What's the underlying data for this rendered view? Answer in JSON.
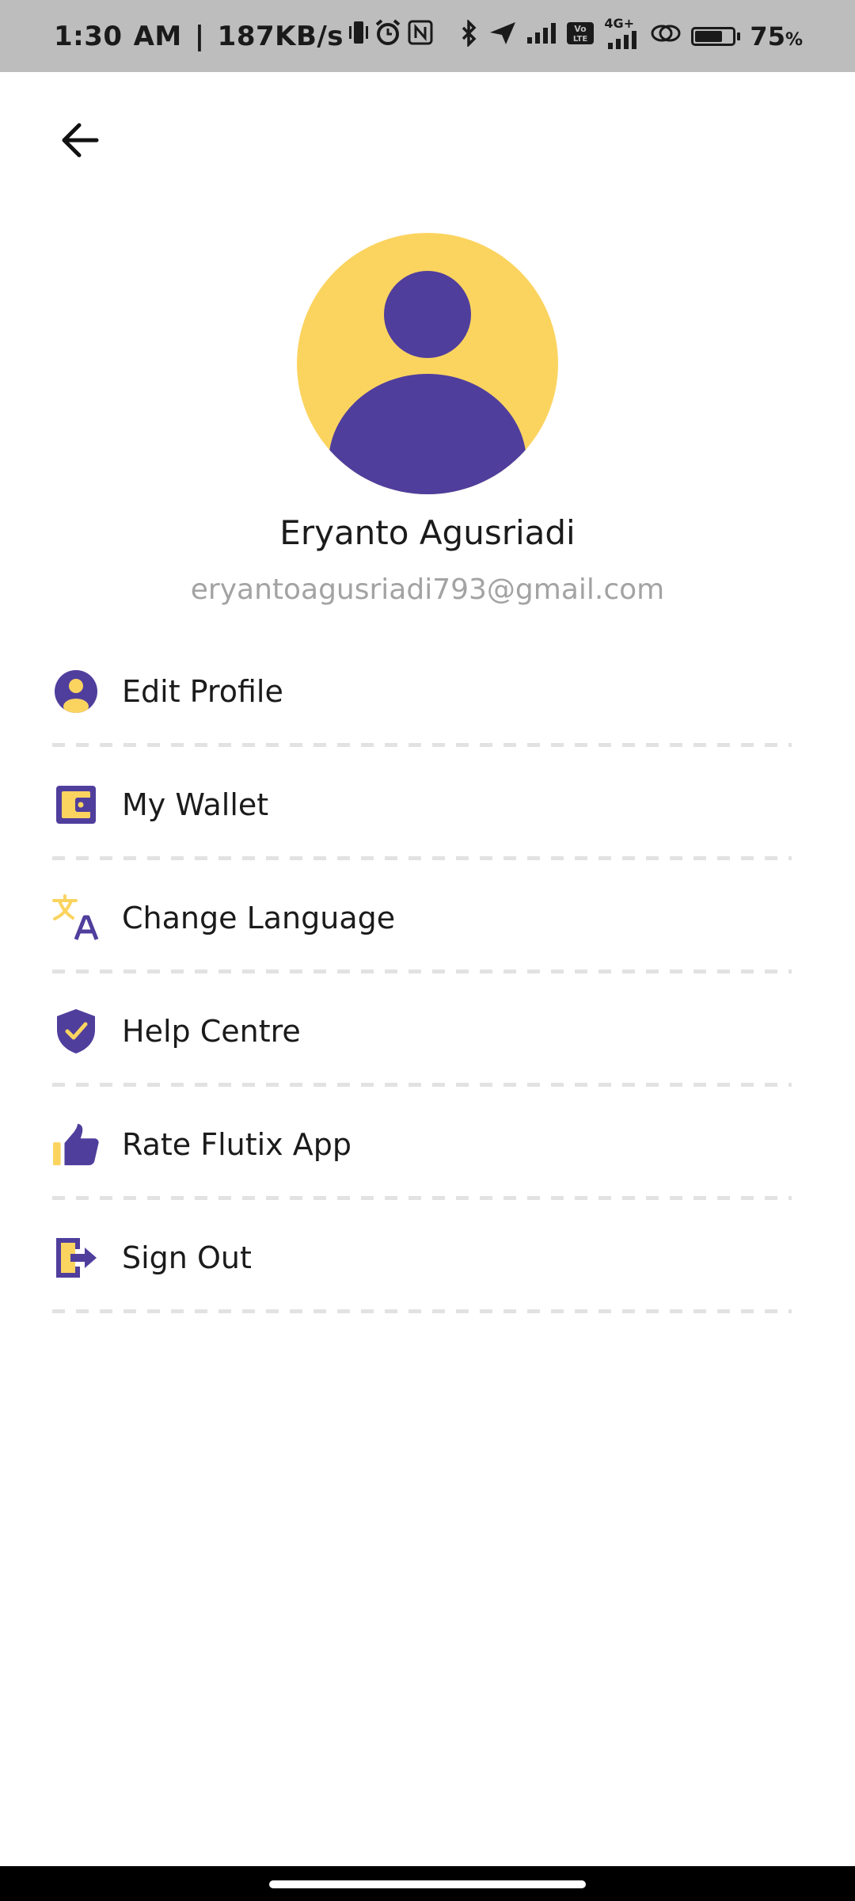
{
  "status_bar": {
    "time": "1:30",
    "ampm": "AM",
    "network_speed": "187KB/s",
    "battery": "75",
    "battery_unit": "%",
    "battery_level": 0.75,
    "network_label": "4G+",
    "volte_label": "Vo LTE"
  },
  "header": {
    "back_icon": "arrow-left-icon"
  },
  "profile": {
    "name": "Eryanto Agusriadi",
    "email": "eryantoagusriadi793@gmail.com",
    "avatar_icon": "user-avatar-icon"
  },
  "menu": {
    "items": [
      {
        "label": "Edit Profile",
        "icon": "user-circle-icon"
      },
      {
        "label": "My Wallet",
        "icon": "wallet-icon"
      },
      {
        "label": "Change Language",
        "icon": "translate-icon"
      },
      {
        "label": "Help Centre",
        "icon": "shield-check-icon"
      },
      {
        "label": "Rate Flutix App",
        "icon": "thumbs-up-icon"
      },
      {
        "label": "Sign Out",
        "icon": "sign-out-icon"
      }
    ]
  },
  "colors": {
    "accent_yellow": "#FBD460",
    "accent_purple": "#503E9D",
    "status_bar_bg": "#BDBDBD",
    "divider": "#E2E2E2",
    "email_gray": "#A3A3A3"
  }
}
